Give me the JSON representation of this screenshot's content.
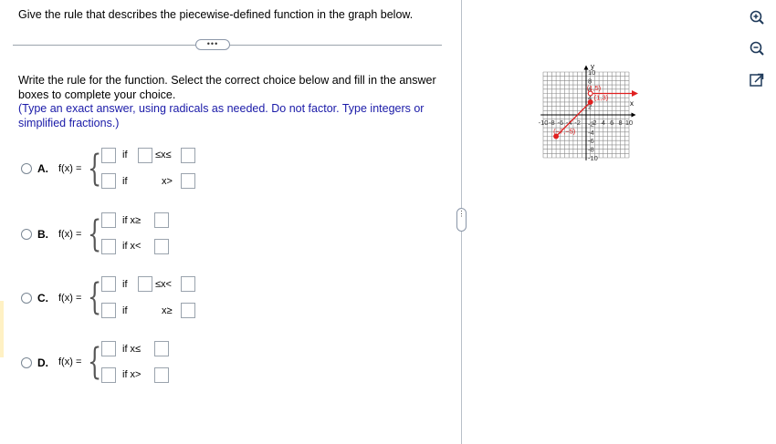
{
  "question": "Give the rule that describes the piecewise-defined function in the graph below.",
  "more_button": "•••",
  "instructions": {
    "line1": "Write the rule for the function. Select the correct choice below and fill in the answer boxes to complete your choice.",
    "note": "(Type an exact answer, using radicals as needed. Do not factor. Type integers or simplified fractions.)"
  },
  "choices": [
    {
      "letter": "A.",
      "fx": "f(x) =",
      "row1_mid": "if",
      "row1_rel": "≤x≤",
      "row2_mid": "if",
      "row2_rel": "x>"
    },
    {
      "letter": "B.",
      "fx": "f(x) =",
      "row1": "if  x≥",
      "row2": "if  x<"
    },
    {
      "letter": "C.",
      "fx": "f(x) =",
      "row1_mid": "if",
      "row1_rel": "≤x<",
      "row2_mid": "if",
      "row2_rel": "x≥"
    },
    {
      "letter": "D.",
      "fx": "f(x) =",
      "row1": "if  x≤",
      "row2": "if  x>"
    }
  ],
  "graph": {
    "x_axis_label": "x",
    "y_axis_label": "y",
    "x_ticks": [
      "-10",
      "-8",
      "-6",
      "-4",
      "-2",
      "2",
      "4",
      "6",
      "8",
      "10"
    ],
    "y_ticks": [
      "10",
      "8",
      "6",
      "4",
      "2",
      "-2",
      "-4",
      "-6",
      "-8",
      "-10"
    ],
    "points": [
      {
        "label": "(1,5)",
        "x": 1,
        "y": 5,
        "filled": false
      },
      {
        "label": "(1,3)",
        "x": 1,
        "y": 3,
        "filled": true
      },
      {
        "label": "(−7,−5)",
        "x": -7,
        "y": -5,
        "filled": true
      }
    ],
    "segments": [
      {
        "from": [
          -7,
          -5
        ],
        "to": [
          1,
          3
        ],
        "kind": "segment"
      },
      {
        "from": [
          1,
          5
        ],
        "to": [
          10,
          5
        ],
        "kind": "ray-right"
      }
    ],
    "curve_color": "#e02020",
    "grid_color": "#8a8a8a"
  },
  "side_tools": [
    "zoom-in-icon",
    "zoom-out-icon",
    "popout-icon"
  ],
  "collapse_handle": "⋮"
}
